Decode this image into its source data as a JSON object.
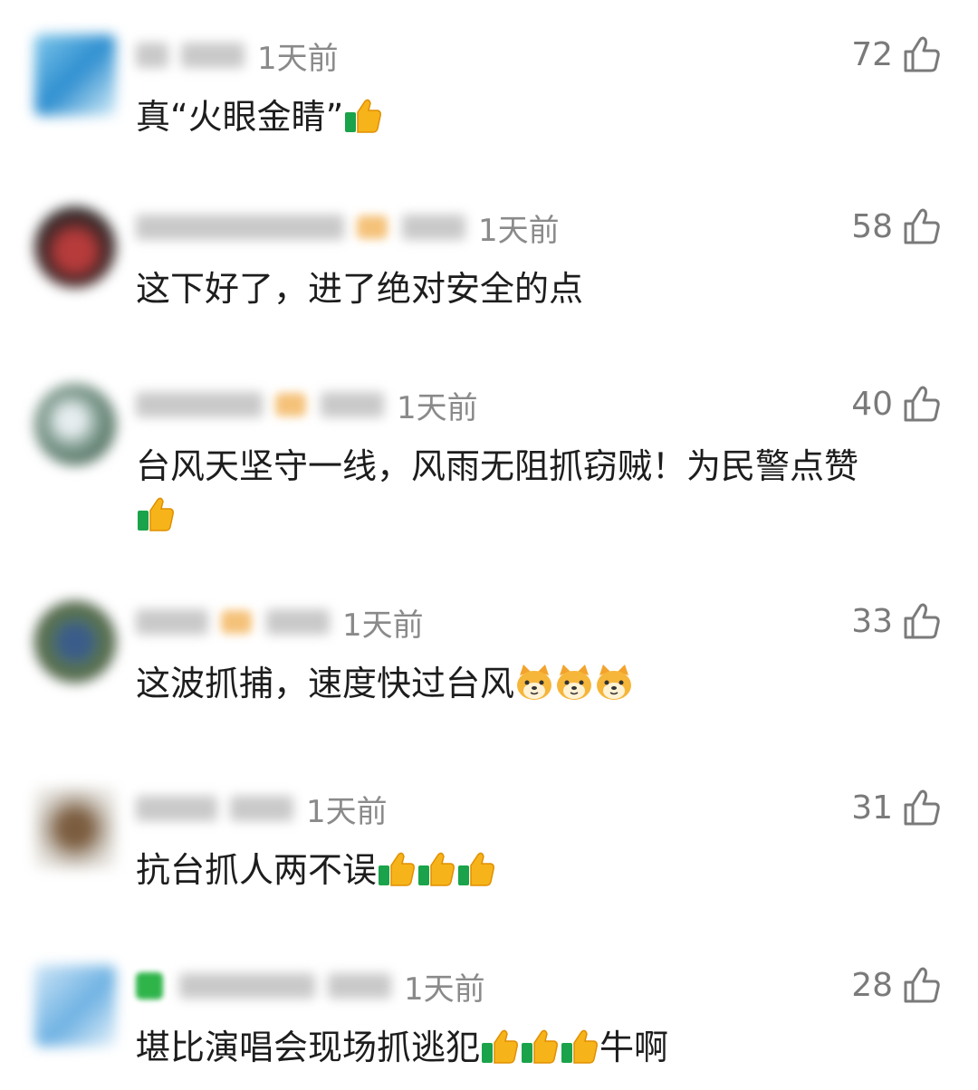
{
  "comments": [
    {
      "time": "1天前",
      "likes": "72",
      "text": "真“火眼金睛”",
      "emojis": [
        "thumbs-up"
      ]
    },
    {
      "time": "1天前",
      "likes": "58",
      "text": "这下好了，进了绝对安全的点",
      "emojis": []
    },
    {
      "time": "1天前",
      "likes": "40",
      "text": "台风天坚守一线，风雨无阻抓窃贼！为民警点赞",
      "emojis": [
        "thumbs-up"
      ]
    },
    {
      "time": "1天前",
      "likes": "33",
      "text": "这波抓捕，速度快过台风",
      "emojis": [
        "doge",
        "doge",
        "doge"
      ]
    },
    {
      "time": "1天前",
      "likes": "31",
      "text": "抗台抓人两不误",
      "emojis": [
        "thumbs-up",
        "thumbs-up",
        "thumbs-up"
      ]
    },
    {
      "time": "1天前",
      "likes": "28",
      "text": "堪比演唱会现场抓逃犯",
      "emojis": [
        "thumbs-up",
        "thumbs-up",
        "thumbs-up"
      ],
      "suffix": "牛啊"
    }
  ],
  "icons": {
    "like": "thumbs-up-outline-icon"
  }
}
